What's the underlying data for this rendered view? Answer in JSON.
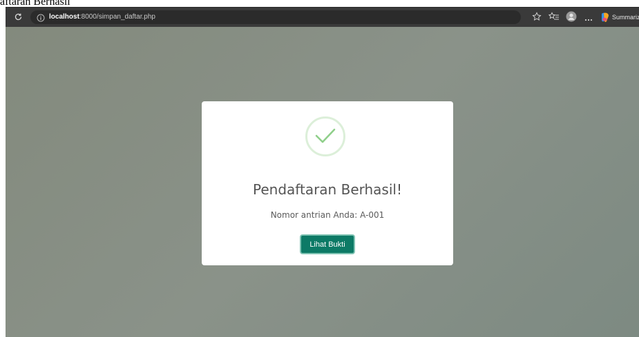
{
  "document": {
    "title_fragment": "aftaran Berhasil"
  },
  "browser": {
    "url_host": "localhost",
    "url_path": ":8000/simpan_daftar.php",
    "summarize_label": "Summariz"
  },
  "modal": {
    "title": "Pendaftaran Berhasil!",
    "message": "Nomor antrian Anda: A-001",
    "button_label": "Lihat Bukti",
    "check_color": "#8fcf8a",
    "button_color": "#0d7a66"
  },
  "icons": [
    "refresh-icon",
    "info-icon",
    "favorite-star-icon",
    "favorites-list-icon",
    "profile-icon",
    "more-icon",
    "copilot-icon",
    "check-icon"
  ]
}
